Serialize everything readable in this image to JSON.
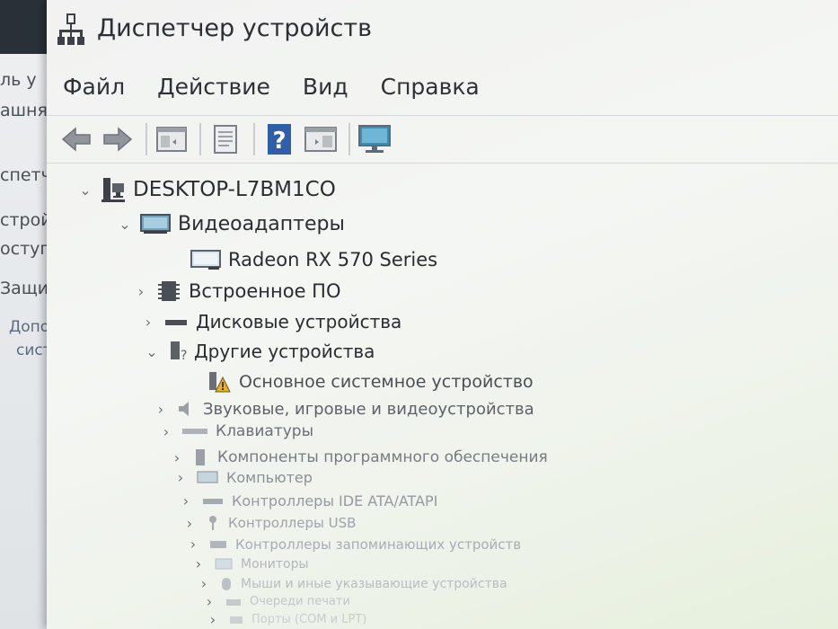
{
  "window": {
    "title": "Диспетчер устройств"
  },
  "background_window": {
    "lines": [
      "ль у",
      "ашня",
      "спетче",
      "строй",
      "оступа",
      "Защита с",
      "Дополни",
      "системы"
    ]
  },
  "menu": {
    "items": [
      "Файл",
      "Действие",
      "Вид",
      "Справка"
    ]
  },
  "toolbar": {
    "buttons": [
      "back-arrow",
      "forward-arrow",
      "show-hide-tree",
      "properties",
      "help",
      "action-pane",
      "monitor"
    ]
  },
  "tree": {
    "root": "DESKTOP-L7BM1CO",
    "video_adapters": "Видеоадаптеры",
    "radeon": "Radeon RX 570 Series",
    "firmware": "Встроенное ПО",
    "disk_devices": "Дисковые устройства",
    "other_devices": "Другие устройства",
    "base_system_device": "Основное системное устройство",
    "sound_devices": "Звуковые, игровые и видеоустройства",
    "keyboards": "Клавиатуры",
    "software_components": "Компоненты программного обеспечения",
    "computer": "Компьютер",
    "ide_controllers": "Контроллеры IDE ATA/ATAPI",
    "usb_controllers": "Контроллеры USB",
    "storage_controllers": "Контроллеры запоминающих устройств",
    "monitors": "Мониторы",
    "mice": "Мыши и иные указывающие устройства",
    "print_queues": "Очереди печати",
    "ports": "Порты (COM и LPT)"
  },
  "colors": {
    "window_bg": "#f1f2f1",
    "help_icon": "#2f5fa8",
    "monitor_icon": "#3a8fb7",
    "warning": "#e8b21a"
  }
}
